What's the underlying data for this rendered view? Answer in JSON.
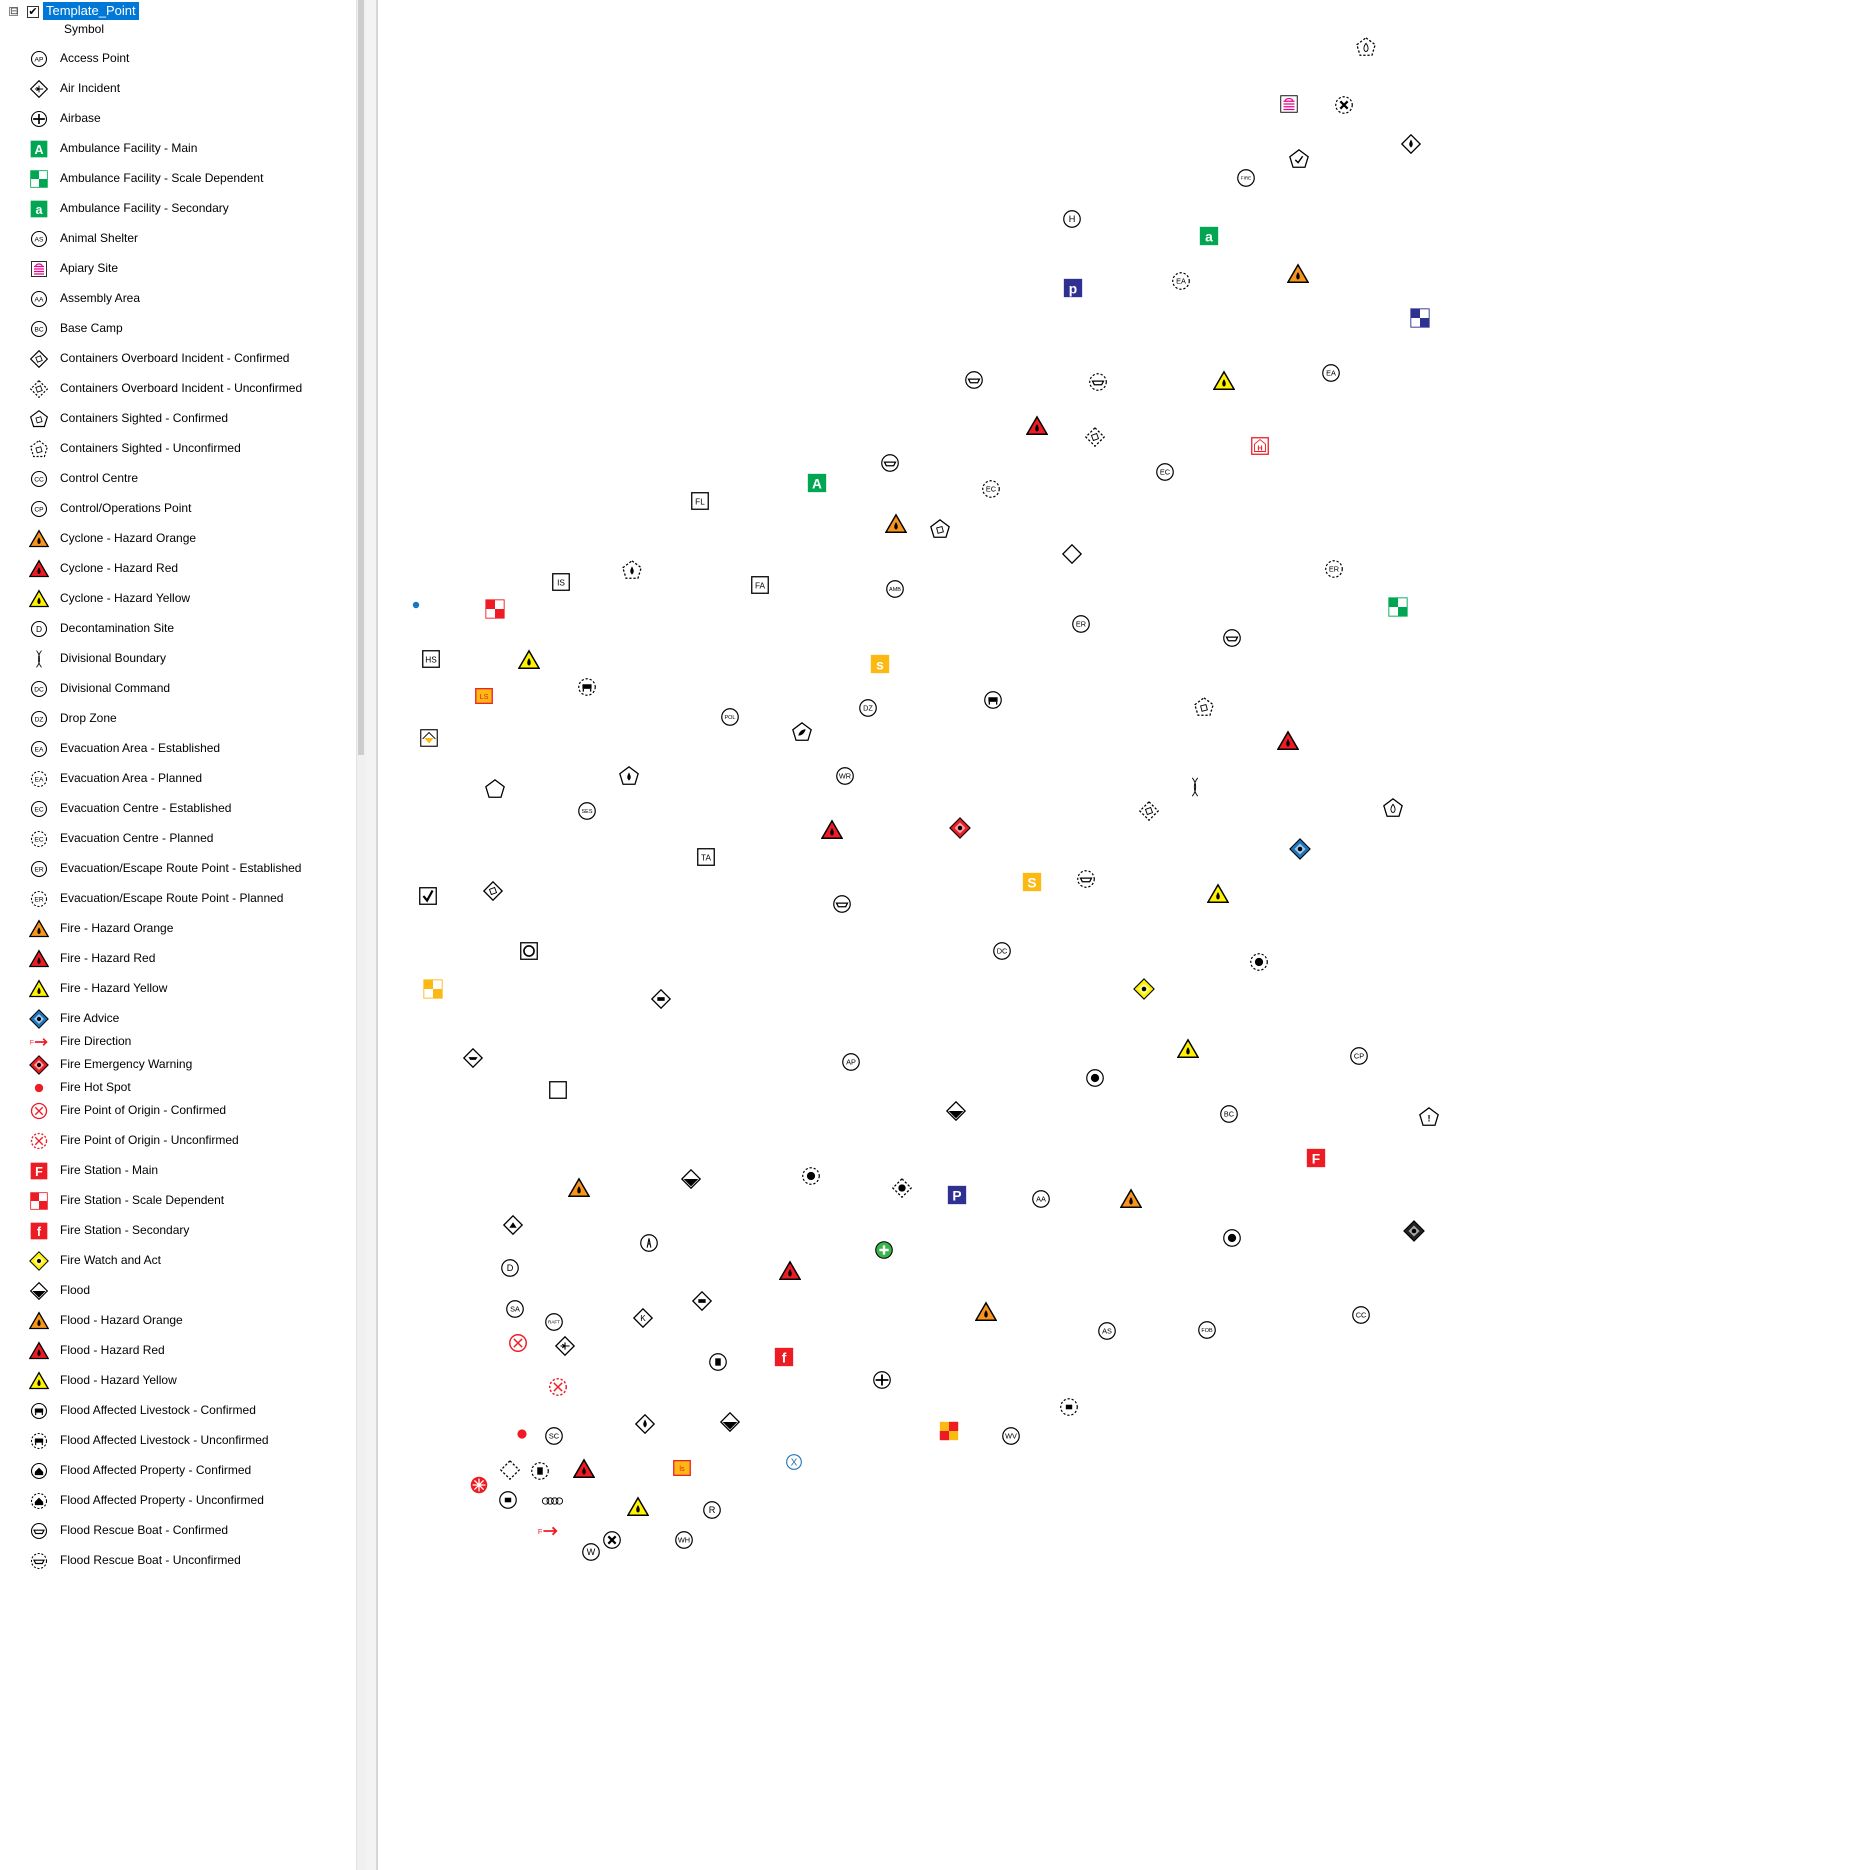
{
  "toc": {
    "layer_name": "Template_Point",
    "expander_glyph": "⊟",
    "checkbox_glyph": "✔",
    "column_header": "Symbol",
    "entries": [
      {
        "label": "Access Point",
        "icon": "circle-code",
        "code": "AP"
      },
      {
        "label": "Air Incident",
        "icon": "diamond-plane"
      },
      {
        "label": "Airbase",
        "icon": "circle-plane"
      },
      {
        "label": "Ambulance Facility - Main",
        "icon": "square-letter",
        "letter": "A",
        "color": "#00a651"
      },
      {
        "label": "Ambulance Facility - Scale Dependent",
        "icon": "checker",
        "color": "#00a651"
      },
      {
        "label": "Ambulance Facility - Secondary",
        "icon": "square-letter",
        "letter": "a",
        "color": "#00a651"
      },
      {
        "label": "Animal Shelter",
        "icon": "circle-code",
        "code": "AS"
      },
      {
        "label": "Apiary Site",
        "icon": "apiary"
      },
      {
        "label": "Assembly Area",
        "icon": "circle-code",
        "code": "AA"
      },
      {
        "label": "Base Camp",
        "icon": "circle-code",
        "code": "BC"
      },
      {
        "label": "Containers Overboard Incident - Confirmed",
        "icon": "diamond-box"
      },
      {
        "label": "Containers Overboard Incident - Unconfirmed",
        "icon": "diamond-box-dashed"
      },
      {
        "label": "Containers Sighted - Confirmed",
        "icon": "pentagon-box"
      },
      {
        "label": "Containers Sighted - Unconfirmed",
        "icon": "pentagon-box-dashed"
      },
      {
        "label": "Control Centre",
        "icon": "circle-code",
        "code": "CC"
      },
      {
        "label": "Control/Operations Point",
        "icon": "circle-code",
        "code": "CP"
      },
      {
        "label": "Cyclone - Hazard Orange",
        "icon": "triangle-hazard",
        "color": "#f7941d"
      },
      {
        "label": "Cyclone - Hazard Red",
        "icon": "triangle-hazard",
        "color": "#ed1c24"
      },
      {
        "label": "Cyclone - Hazard Yellow",
        "icon": "triangle-hazard",
        "color": "#fff200"
      },
      {
        "label": "Decontamination Site",
        "icon": "circle-code",
        "code": "D"
      },
      {
        "label": "Divisional Boundary",
        "icon": "boundary"
      },
      {
        "label": "Divisional Command",
        "icon": "circle-code",
        "code": "DC"
      },
      {
        "label": "Drop Zone",
        "icon": "circle-code",
        "code": "DZ"
      },
      {
        "label": "Evacuation Area - Established",
        "icon": "circle-code",
        "code": "EA"
      },
      {
        "label": "Evacuation Area - Planned",
        "icon": "circle-code-dashed",
        "code": "EA"
      },
      {
        "label": "Evacuation Centre - Established",
        "icon": "circle-code",
        "code": "EC"
      },
      {
        "label": "Evacuation Centre - Planned",
        "icon": "circle-code-dashed",
        "code": "EC"
      },
      {
        "label": "Evacuation/Escape Route Point - Established",
        "icon": "circle-code",
        "code": "ER"
      },
      {
        "label": "Evacuation/Escape Route Point - Planned",
        "icon": "circle-code-dashed",
        "code": "ER"
      },
      {
        "label": "Fire - Hazard Orange",
        "icon": "triangle-hazard",
        "color": "#f7941d"
      },
      {
        "label": "Fire - Hazard Red",
        "icon": "triangle-hazard",
        "color": "#ed1c24"
      },
      {
        "label": "Fire - Hazard Yellow",
        "icon": "triangle-hazard",
        "color": "#fff200"
      },
      {
        "label": "Fire Advice",
        "icon": "diamond-fill",
        "color": "#1c75bc"
      },
      {
        "label": "Fire Direction",
        "icon": "arrow",
        "color": "#ed1c24"
      },
      {
        "label": "Fire Emergency Warning",
        "icon": "diamond-fill",
        "color": "#ed1c24"
      },
      {
        "label": "Fire Hot Spot",
        "icon": "dot",
        "color": "#ed1c24"
      },
      {
        "label": "Fire Point of Origin - Confirmed",
        "icon": "circle-x",
        "color": "#ed1c24"
      },
      {
        "label": "Fire Point of Origin - Unconfirmed",
        "icon": "circle-x-dashed",
        "color": "#ed1c24"
      },
      {
        "label": "Fire Station - Main",
        "icon": "square-letter",
        "letter": "F",
        "color": "#ed1c24"
      },
      {
        "label": "Fire Station - Scale Dependent",
        "icon": "checker",
        "color": "#ed1c24"
      },
      {
        "label": "Fire Station - Secondary",
        "icon": "square-letter",
        "letter": "f",
        "color": "#ed1c24"
      },
      {
        "label": "Fire Watch and Act",
        "icon": "diamond-fill",
        "color": "#fff200"
      },
      {
        "label": "Flood",
        "icon": "flood"
      },
      {
        "label": "Flood - Hazard Orange",
        "icon": "triangle-hazard",
        "color": "#f7941d"
      },
      {
        "label": "Flood - Hazard Red",
        "icon": "triangle-hazard",
        "color": "#ed1c24"
      },
      {
        "label": "Flood - Hazard Yellow",
        "icon": "triangle-hazard",
        "color": "#fff200"
      },
      {
        "label": "Flood Affected Livestock - Confirmed",
        "icon": "circle-cow"
      },
      {
        "label": "Flood Affected Livestock - Unconfirmed",
        "icon": "circle-cow-dashed"
      },
      {
        "label": "Flood Affected Property - Confirmed",
        "icon": "circle-house"
      },
      {
        "label": "Flood Affected Property - Unconfirmed",
        "icon": "circle-house-dashed"
      },
      {
        "label": "Flood Rescue Boat - Confirmed",
        "icon": "circle-boat"
      },
      {
        "label": "Flood Rescue Boat - Unconfirmed",
        "icon": "circle-boat-dashed"
      }
    ]
  },
  "map": {
    "markers": [
      {
        "icon": "pentagon-fire-dashed"
      },
      {
        "icon": "apiary"
      },
      {
        "icon": "circle-xmark-dashed"
      },
      {
        "icon": "diamond-drop"
      },
      {
        "icon": "pentagon-check"
      },
      {
        "icon": "circle-code",
        "code": "FIRE"
      },
      {
        "icon": "circle-code",
        "code": "H"
      },
      {
        "icon": "square-letter",
        "letter": "a",
        "color": "#00a651"
      },
      {
        "icon": "square-letter",
        "letter": "p",
        "color": "#2e3192"
      },
      {
        "icon": "circle-code-dashed",
        "code": "EA"
      },
      {
        "icon": "triangle-hazard",
        "color": "#f7941d"
      },
      {
        "icon": "checker",
        "color": "#2e3192"
      },
      {
        "icon": "circle-boat"
      },
      {
        "icon": "circle-boat-dashed"
      },
      {
        "icon": "triangle-hazard",
        "color": "#fff200"
      },
      {
        "icon": "circle-code",
        "code": "EA"
      },
      {
        "icon": "triangle-hazard",
        "color": "#ed1c24"
      },
      {
        "icon": "diamond-box-dashed"
      },
      {
        "icon": "square-h"
      },
      {
        "icon": "circle-boat"
      },
      {
        "icon": "square-letter",
        "letter": "A",
        "color": "#00a651"
      },
      {
        "icon": "circle-code-dashed",
        "code": "EC"
      },
      {
        "icon": "circle-code",
        "code": "EC"
      },
      {
        "icon": "square-code",
        "code": "FL"
      },
      {
        "icon": "triangle-hazard",
        "color": "#f7941d"
      },
      {
        "icon": "pentagon-box"
      },
      {
        "icon": "diamond"
      },
      {
        "icon": "square-code",
        "code": "IS"
      },
      {
        "icon": "pentagon-drop-dashed"
      },
      {
        "icon": "square-code",
        "code": "FA"
      },
      {
        "icon": "circle-code",
        "code": "AMB"
      },
      {
        "icon": "circle-code-dashed",
        "code": "ER"
      },
      {
        "icon": "dot",
        "color": "#1c75bc"
      },
      {
        "icon": "checker",
        "color": "#ed1c24"
      },
      {
        "icon": "circle-code",
        "code": "ER"
      },
      {
        "icon": "checker",
        "color": "#00a651"
      },
      {
        "icon": "circle-boat"
      },
      {
        "icon": "square-code",
        "code": "HS"
      },
      {
        "icon": "triangle-hazard",
        "color": "#fff200"
      },
      {
        "icon": "circle-cow-dashed"
      },
      {
        "icon": "square-letter",
        "letter": "s",
        "color": "#fdb913"
      },
      {
        "icon": "square-code-yellow",
        "code": "LS"
      },
      {
        "icon": "circle-cow"
      },
      {
        "icon": "circle-code",
        "code": "POL"
      },
      {
        "icon": "pentagon-leaf"
      },
      {
        "icon": "circle-code",
        "code": "DZ"
      },
      {
        "icon": "pentagon-box-dashed"
      },
      {
        "icon": "square-house"
      },
      {
        "icon": "triangle-hazard",
        "color": "#ed1c24"
      },
      {
        "icon": "pentagon-flask"
      },
      {
        "icon": "pentagon"
      },
      {
        "icon": "pentagon-drop"
      },
      {
        "icon": "circle-code",
        "code": "WR"
      },
      {
        "icon": "boundary"
      },
      {
        "icon": "pentagon-fire"
      },
      {
        "icon": "circle-code",
        "code": "SES"
      },
      {
        "icon": "diamond-box-dashed"
      },
      {
        "icon": "triangle-hazard",
        "color": "#ed1c24"
      },
      {
        "icon": "diamond-fill",
        "color": "#ed1c24"
      },
      {
        "icon": "diamond-fill",
        "color": "#1c75bc"
      },
      {
        "icon": "square-x"
      },
      {
        "icon": "square-code",
        "code": "TA"
      },
      {
        "icon": "square-letter",
        "letter": "S",
        "color": "#fdb913"
      },
      {
        "icon": "circle-boat-dashed"
      },
      {
        "icon": "square-check"
      },
      {
        "icon": "diamond-box"
      },
      {
        "icon": "circle-boat"
      },
      {
        "icon": "triangle-hazard",
        "color": "#fff200"
      },
      {
        "icon": "square-ring"
      },
      {
        "icon": "circle-code",
        "code": "DC"
      },
      {
        "icon": "circle-figure-dashed"
      },
      {
        "icon": "checker",
        "color": "#fdb913"
      },
      {
        "icon": "diamond-fill",
        "color": "#fff200"
      },
      {
        "icon": "diamond-car"
      },
      {
        "icon": "triangle-hazard",
        "color": "#fff200"
      },
      {
        "icon": "diamond-boat"
      },
      {
        "icon": "circle-code",
        "code": "AP"
      },
      {
        "icon": "circle-figure"
      },
      {
        "icon": "circle-code",
        "code": "CP"
      },
      {
        "icon": "square"
      },
      {
        "icon": "flood"
      },
      {
        "icon": "circle-code",
        "code": "BC"
      },
      {
        "icon": "pentagon-bang"
      },
      {
        "icon": "square-letter",
        "letter": "F",
        "color": "#ed1c24"
      },
      {
        "icon": "triangle-hazard",
        "color": "#f7941d"
      },
      {
        "icon": "flood"
      },
      {
        "icon": "circle-figure-dashed"
      },
      {
        "icon": "diamond-burst"
      },
      {
        "icon": "square-letter",
        "letter": "P",
        "color": "#2e3192"
      },
      {
        "icon": "circle-code",
        "code": "AA"
      },
      {
        "icon": "triangle-hazard",
        "color": "#f7941d"
      },
      {
        "icon": "circle-figure"
      },
      {
        "icon": "diamond-mountain"
      },
      {
        "icon": "circle-tower"
      },
      {
        "icon": "circle-plus-green"
      },
      {
        "icon": "diamond-fill",
        "color": "#222222"
      },
      {
        "icon": "triangle-hazard",
        "color": "#ed1c24"
      },
      {
        "icon": "circle-code",
        "code": "D"
      },
      {
        "icon": "diamond-car"
      },
      {
        "icon": "circle-code",
        "code": "SA"
      },
      {
        "icon": "circle-code",
        "code": "RAFT"
      },
      {
        "icon": "diamond-k"
      },
      {
        "icon": "triangle-hazard",
        "color": "#f7941d"
      },
      {
        "icon": "circle-code",
        "code": "AS"
      },
      {
        "icon": "circle-code",
        "code": "FOB"
      },
      {
        "icon": "circle-code",
        "code": "CC"
      },
      {
        "icon": "circle-x",
        "color": "#ed1c24"
      },
      {
        "icon": "diamond-plane"
      },
      {
        "icon": "circle-trash"
      },
      {
        "icon": "square-letter",
        "letter": "f",
        "color": "#ed1c24"
      },
      {
        "icon": "circle-plane"
      },
      {
        "icon": "circle-x-dashed",
        "color": "#ed1c24"
      },
      {
        "icon": "circle-square-dashed"
      },
      {
        "icon": "diamond-drop"
      },
      {
        "icon": "flood"
      },
      {
        "icon": "checker-yellow-red"
      },
      {
        "icon": "circle-code",
        "code": "WV"
      },
      {
        "icon": "dot",
        "color": "#ed1c24"
      },
      {
        "icon": "circle-code",
        "code": "SC"
      },
      {
        "icon": "diamond-dashed"
      },
      {
        "icon": "circle-trash-dashed"
      },
      {
        "icon": "triangle-hazard",
        "color": "#ed1c24"
      },
      {
        "icon": "square-code-yellow",
        "code": "ls"
      },
      {
        "icon": "circle-x-blue"
      },
      {
        "icon": "circle-burst-red"
      },
      {
        "icon": "circle-square"
      },
      {
        "icon": "rings"
      },
      {
        "icon": "triangle-hazard",
        "color": "#fff200"
      },
      {
        "icon": "circle-code",
        "code": "R"
      },
      {
        "icon": "arrow",
        "color": "#ed1c24"
      },
      {
        "icon": "circle-code",
        "code": "W"
      },
      {
        "icon": "circle-xmark"
      },
      {
        "icon": "circle-code",
        "code": "WH"
      }
    ]
  }
}
